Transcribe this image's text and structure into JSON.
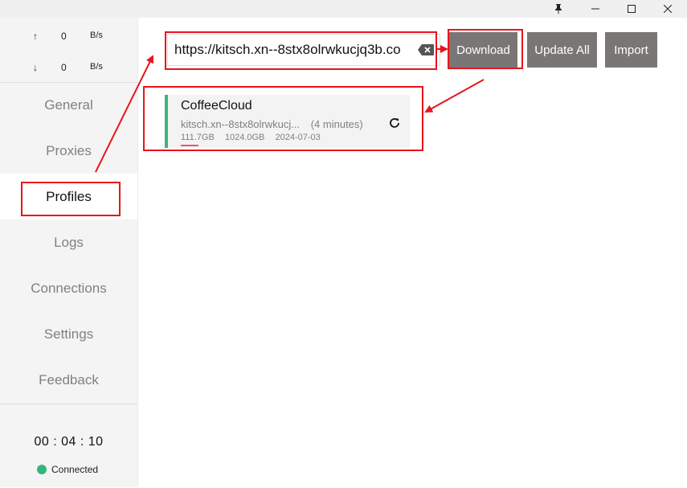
{
  "window": {
    "controls": {
      "pin_icon": "pin-icon",
      "minimize_icon": "minimize-icon",
      "maximize_icon": "maximize-icon",
      "close_icon": "close-icon"
    }
  },
  "traffic": {
    "upload": {
      "arrow": "↑",
      "value": "0",
      "unit": "B/s"
    },
    "download": {
      "arrow": "↓",
      "value": "0",
      "unit": "B/s"
    }
  },
  "nav": {
    "items": [
      {
        "label": "General"
      },
      {
        "label": "Proxies"
      },
      {
        "label": "Profiles"
      },
      {
        "label": "Logs"
      },
      {
        "label": "Connections"
      },
      {
        "label": "Settings"
      },
      {
        "label": "Feedback"
      }
    ],
    "active": "Profiles"
  },
  "footer": {
    "timer": "00 : 04 : 10",
    "status": "Connected",
    "status_color": "#37b47d"
  },
  "toolbar": {
    "url_value": "https://kitsch.xn--8stx8olrwkucjq3b.co",
    "download_label": "Download",
    "update_all_label": "Update All",
    "import_label": "Import",
    "button_color": "#7a7675"
  },
  "profile": {
    "name": "CoffeeCloud",
    "url": "kitsch.xn--8stx8olrwkucj...",
    "updated": "(4 minutes)",
    "used": "111.7GB",
    "total": "1024.0GB",
    "expire": "2024-07-03",
    "accent_color": "#3eb37e"
  },
  "annotation_color": "#e8141c"
}
